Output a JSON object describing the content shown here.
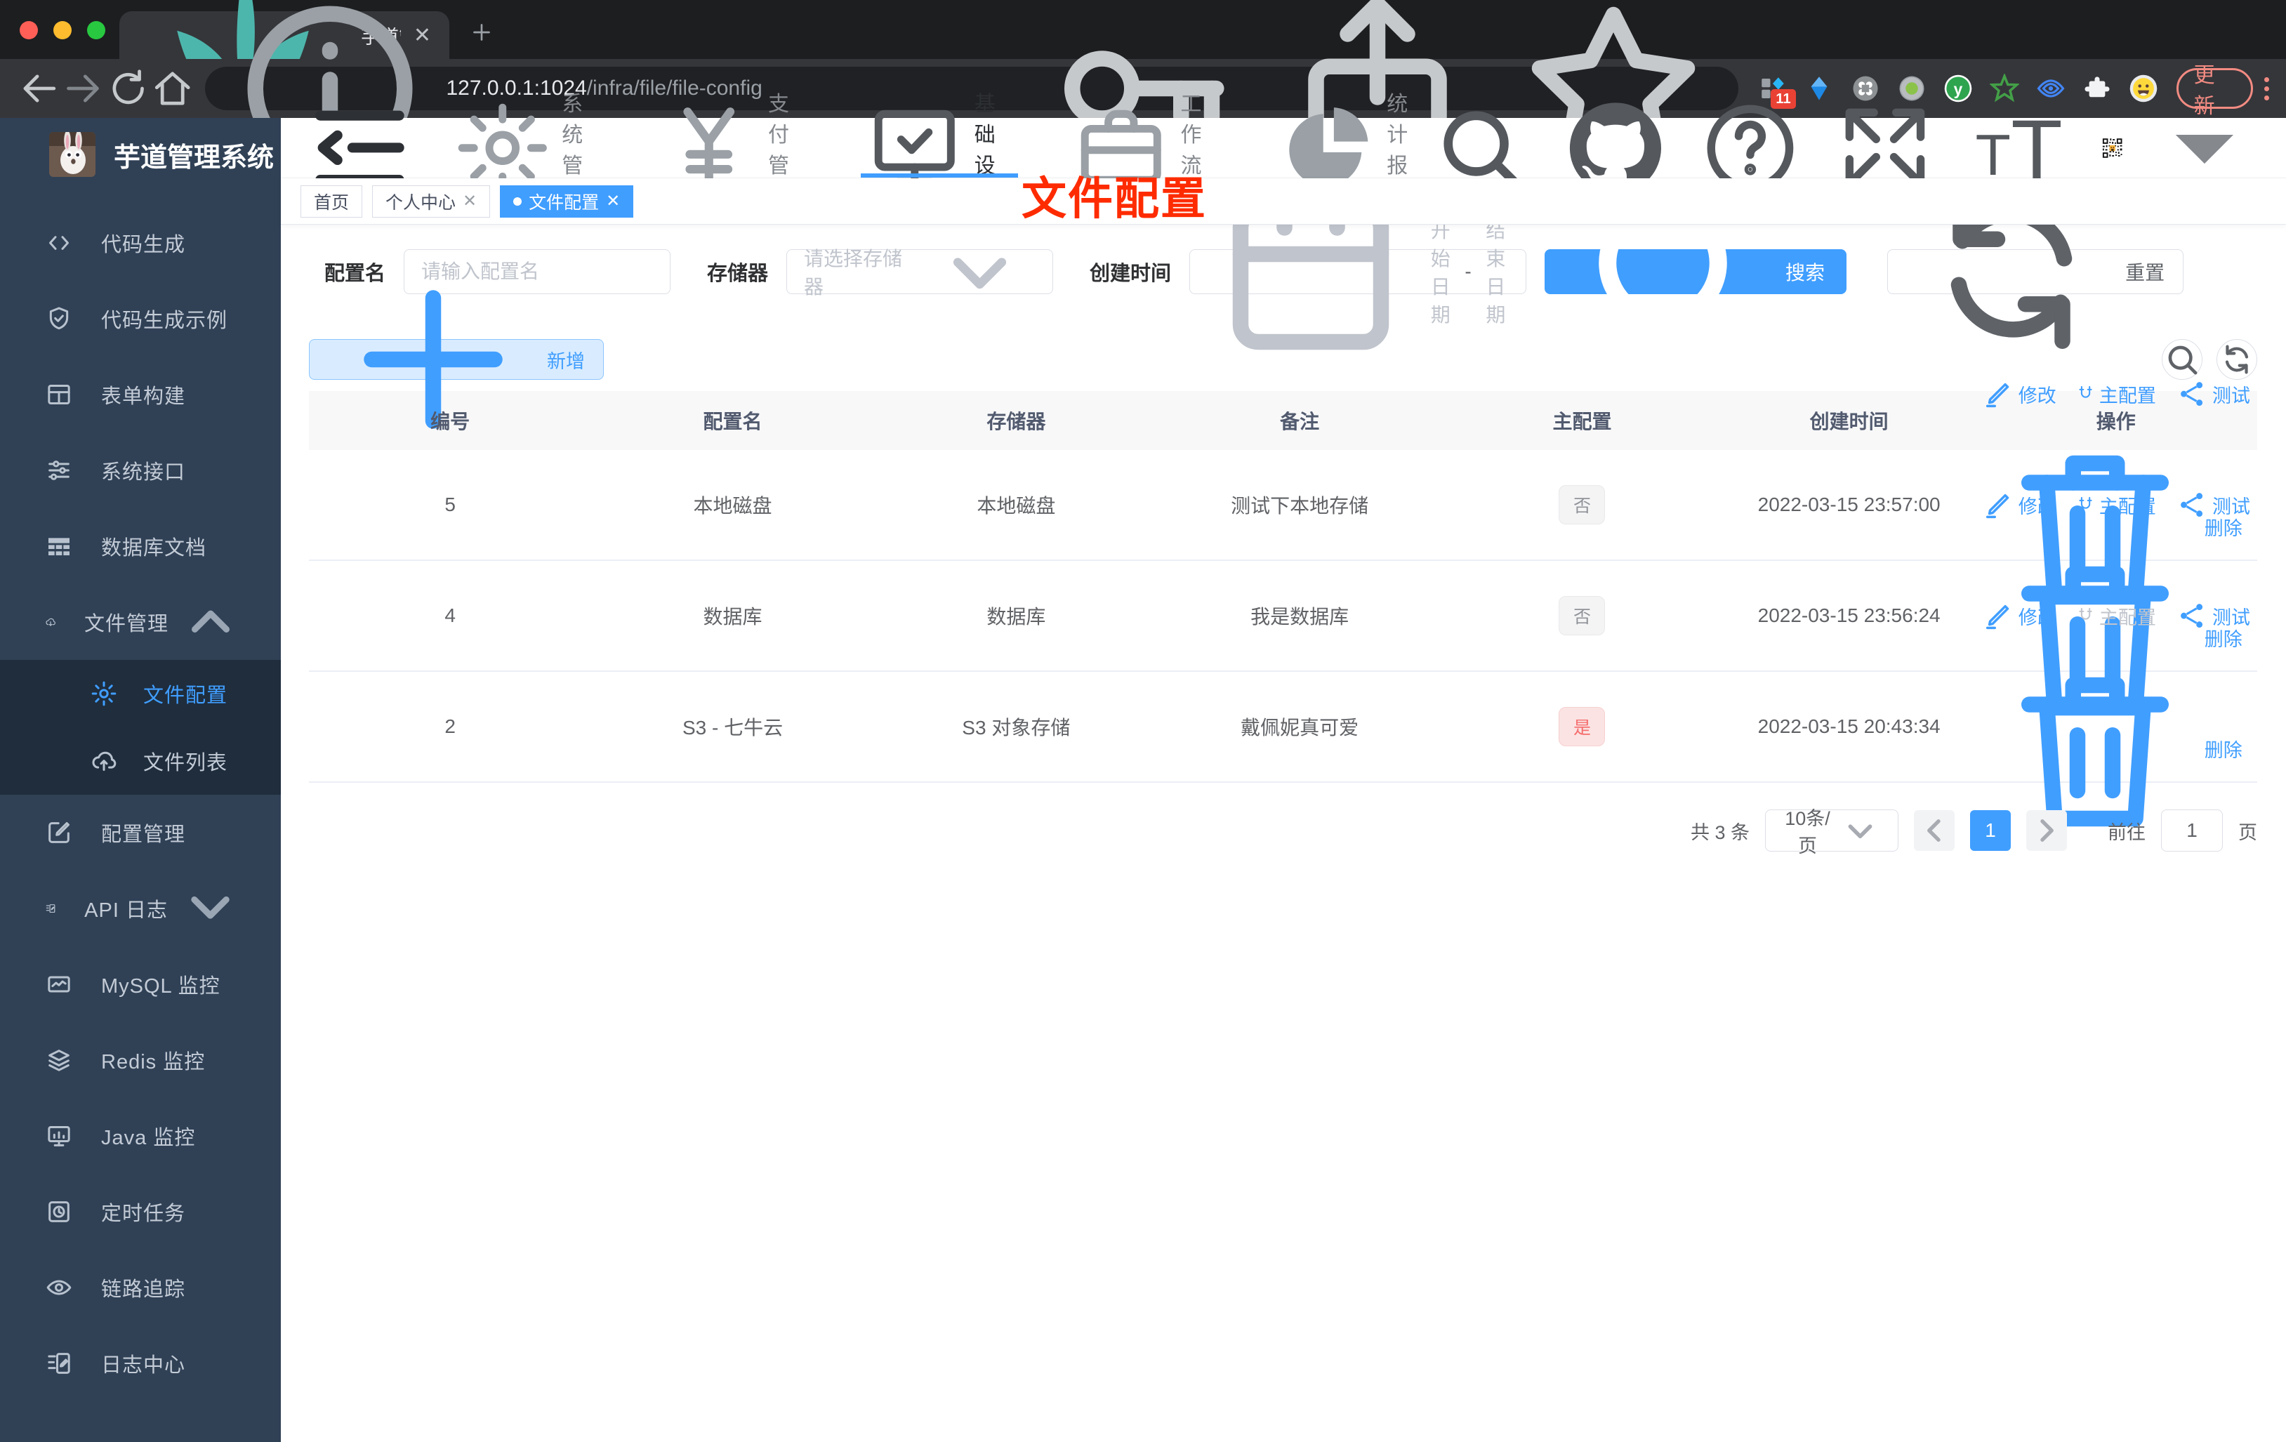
{
  "browser": {
    "tab_title": "芋道管理系统",
    "url_host": "127.0.0.1:1024",
    "url_path": "/infra/file/file-config",
    "extension_badge": "11",
    "update_label": "更新"
  },
  "colors": {
    "accent": "#409eff",
    "danger": "#f56c6c",
    "annotation": "#fe2b00",
    "sidebar_bg": "#304156",
    "submenu_bg": "#1f2d3d"
  },
  "sidebar": {
    "logo_title": "芋道管理系统",
    "items": [
      {
        "label": "代码生成",
        "icon": "code"
      },
      {
        "label": "代码生成示例",
        "icon": "shield-check"
      },
      {
        "label": "表单构建",
        "icon": "form-grid"
      },
      {
        "label": "系统接口",
        "icon": "sliders"
      },
      {
        "label": "数据库文档",
        "icon": "table-grid"
      },
      {
        "label": "文件管理",
        "icon": "cloud-down",
        "expandable": true,
        "expanded": true,
        "children": [
          {
            "label": "文件配置",
            "icon": "gear",
            "active": true
          },
          {
            "label": "文件列表",
            "icon": "cloud-up"
          }
        ]
      },
      {
        "label": "配置管理",
        "icon": "edit-square"
      },
      {
        "label": "API 日志",
        "icon": "doc-edit",
        "expandable": true,
        "expanded": false
      },
      {
        "label": "MySQL 监控",
        "icon": "chart-box"
      },
      {
        "label": "Redis 监控",
        "icon": "layers"
      },
      {
        "label": "Java 监控",
        "icon": "monitor"
      },
      {
        "label": "定时任务",
        "icon": "task-clock"
      },
      {
        "label": "链路追踪",
        "icon": "eye"
      },
      {
        "label": "日志中心",
        "icon": "doc-edit"
      }
    ]
  },
  "header": {
    "nav": [
      {
        "label": "系统管理",
        "icon": "gear"
      },
      {
        "label": "支付管理",
        "icon": "yen"
      },
      {
        "label": "基础设施",
        "icon": "infra",
        "active": true
      },
      {
        "label": "工作流程",
        "icon": "briefcase"
      },
      {
        "label": "统计报表",
        "icon": "pie"
      }
    ]
  },
  "tags": [
    {
      "label": "首页",
      "closable": false,
      "active": false
    },
    {
      "label": "个人中心",
      "closable": true,
      "active": false
    },
    {
      "label": "文件配置",
      "closable": true,
      "active": true
    }
  ],
  "annotation": {
    "text": "文件配置"
  },
  "filters": {
    "config_name_label": "配置名",
    "config_name_placeholder": "请输入配置名",
    "storage_label": "存储器",
    "storage_placeholder": "请选择存储器",
    "create_time_label": "创建时间",
    "start_placeholder": "开始日期",
    "separator": "-",
    "end_placeholder": "结束日期",
    "search_label": "搜索",
    "reset_label": "重置"
  },
  "toolbar": {
    "add_label": "新增"
  },
  "table": {
    "columns": [
      "编号",
      "配置名",
      "存储器",
      "备注",
      "主配置",
      "创建时间",
      "操作"
    ],
    "action_labels": {
      "edit": "修改",
      "master": "主配置",
      "test": "测试",
      "delete": "删除"
    },
    "rows": [
      {
        "id": "5",
        "name": "本地磁盘",
        "storage": "本地磁盘",
        "remark": "测试下本地存储",
        "master": "否",
        "master_type": "info",
        "created": "2022-03-15 23:57:00",
        "master_disabled": false
      },
      {
        "id": "4",
        "name": "数据库",
        "storage": "数据库",
        "remark": "我是数据库",
        "master": "否",
        "master_type": "info",
        "created": "2022-03-15 23:56:24",
        "master_disabled": false
      },
      {
        "id": "2",
        "name": "S3 - 七牛云",
        "storage": "S3 对象存储",
        "remark": "戴佩妮真可爱",
        "master": "是",
        "master_type": "danger",
        "created": "2022-03-15 20:43:34",
        "master_disabled": true
      }
    ]
  },
  "pagination": {
    "total_text": "共 3 条",
    "page_size": "10条/页",
    "current_page": "1",
    "goto_label": "前往",
    "goto_value": "1",
    "page_suffix": "页"
  }
}
